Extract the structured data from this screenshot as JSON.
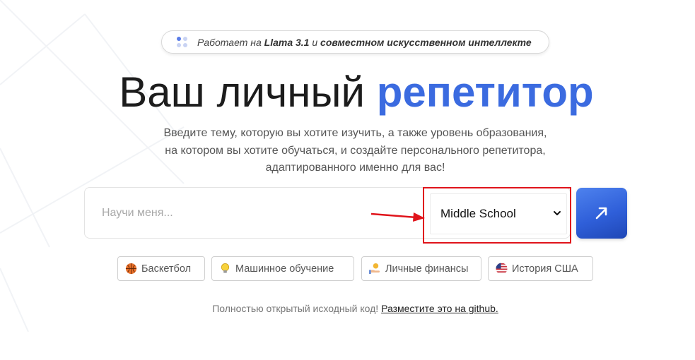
{
  "badge": {
    "prefix": "Работает на ",
    "model": "Llama 3.1",
    "middle": " и ",
    "partner": "совместном искусственном интеллекте"
  },
  "hero": {
    "title_plain": "Ваш личный ",
    "title_accent": "репетитор",
    "subtitle": "Введите тему, которую вы хотите изучить, а также уровень образования, на котором вы хотите обучаться, и создайте персонального репетитора, адаптированного именно для вас!"
  },
  "search": {
    "placeholder": "Научи меня...",
    "value": "",
    "level_selected": "Middle School"
  },
  "suggestions": [
    {
      "label": "Баскетбол",
      "icon": "basketball-icon"
    },
    {
      "label": "Машинное обучение",
      "icon": "lightbulb-icon"
    },
    {
      "label": "Личные финансы",
      "icon": "money-hand-icon"
    },
    {
      "label": "История США",
      "icon": "us-flag-icon"
    }
  ],
  "footer": {
    "text": "Полностью открытый исходный код! ",
    "link": "Разместите это на github."
  },
  "colors": {
    "accent": "#3b6be0",
    "button": "#2f5fd9",
    "annotation": "#e0141b"
  }
}
